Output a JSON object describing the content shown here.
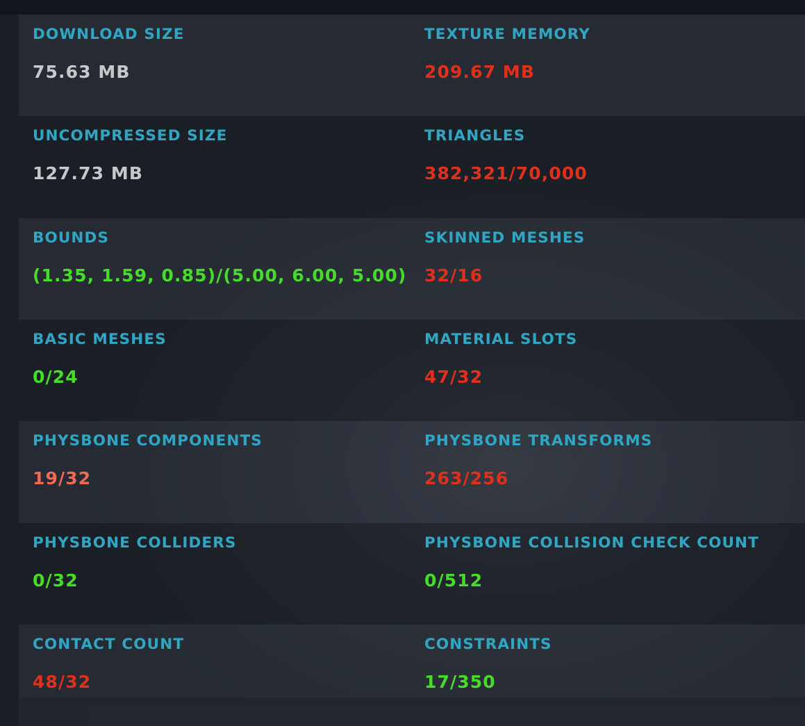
{
  "colors": {
    "label": "#2fa7c4",
    "neutral": "#c6c8cc",
    "bad": "#e0301c",
    "warn": "#ee6a55",
    "good": "#46dc2a"
  },
  "stats": {
    "download_size": {
      "label": "DOWNLOAD SIZE",
      "value": "75.63 MB",
      "status": "neutral"
    },
    "texture_memory": {
      "label": "TEXTURE MEMORY",
      "value": "209.67 MB",
      "status": "bad"
    },
    "uncompressed_size": {
      "label": "UNCOMPRESSED SIZE",
      "value": "127.73 MB",
      "status": "neutral"
    },
    "triangles": {
      "label": "TRIANGLES",
      "value": "382,321/70,000",
      "status": "bad"
    },
    "bounds": {
      "label": "BOUNDS",
      "value": "(1.35, 1.59, 0.85)/(5.00, 6.00, 5.00)",
      "status": "good"
    },
    "skinned_meshes": {
      "label": "SKINNED MESHES",
      "value": "32/16",
      "status": "bad"
    },
    "basic_meshes": {
      "label": "BASIC MESHES",
      "value": "0/24",
      "status": "good"
    },
    "material_slots": {
      "label": "MATERIAL SLOTS",
      "value": "47/32",
      "status": "bad"
    },
    "physbone_components": {
      "label": "PHYSBONE COMPONENTS",
      "value": "19/32",
      "status": "warn"
    },
    "physbone_transforms": {
      "label": "PHYSBONE TRANSFORMS",
      "value": "263/256",
      "status": "bad"
    },
    "physbone_colliders": {
      "label": "PHYSBONE COLLIDERS",
      "value": "0/32",
      "status": "good"
    },
    "physbone_collision_check_count": {
      "label": "PHYSBONE COLLISION CHECK COUNT",
      "value": "0/512",
      "status": "good"
    },
    "contact_count": {
      "label": "CONTACT COUNT",
      "value": "48/32",
      "status": "bad"
    },
    "constraints": {
      "label": "CONSTRAINTS",
      "value": "17/350",
      "status": "good"
    }
  }
}
